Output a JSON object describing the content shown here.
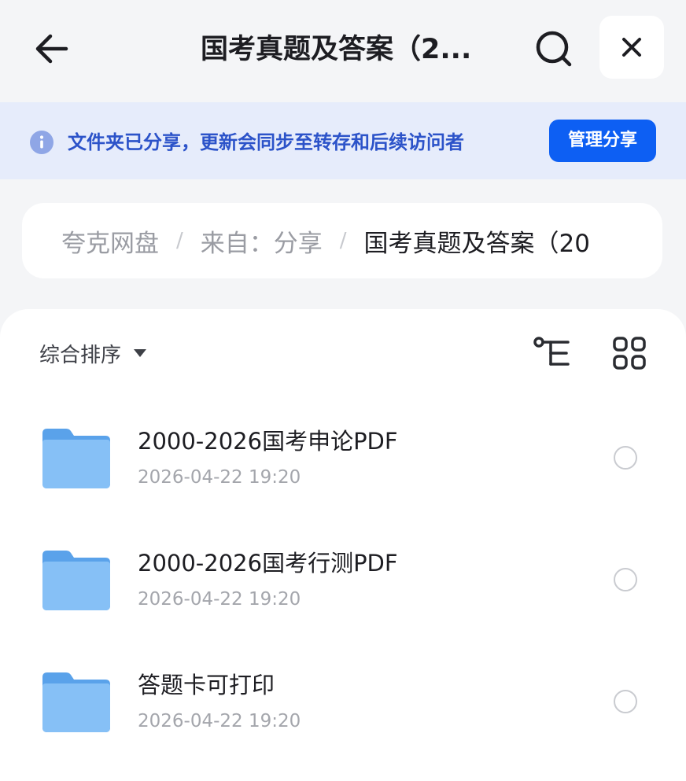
{
  "header": {
    "title": "国考真题及答案（2...",
    "back_icon": "arrow-left-icon",
    "search_icon": "search-icon",
    "close_icon": "close-icon"
  },
  "banner": {
    "text": "文件夹已分享，更新会同步至转存和后续访问者",
    "button_label": "管理分享",
    "accent_color": "#0d5ff3"
  },
  "breadcrumb": {
    "items": [
      "夸克网盘",
      "来自：分享"
    ],
    "separator": "/",
    "current": "国考真题及答案（20"
  },
  "toolbar": {
    "sort_label": "综合排序",
    "tree_icon": "tree-view-icon",
    "grid_icon": "grid-view-icon"
  },
  "files": [
    {
      "name": "2000-2026国考申论PDF",
      "date": "2026-04-22 19:20",
      "type": "folder"
    },
    {
      "name": "2000-2026国考行测PDF",
      "date": "2026-04-22 19:20",
      "type": "folder"
    },
    {
      "name": "答题卡可打印",
      "date": "2026-04-22 19:20",
      "type": "folder"
    }
  ]
}
